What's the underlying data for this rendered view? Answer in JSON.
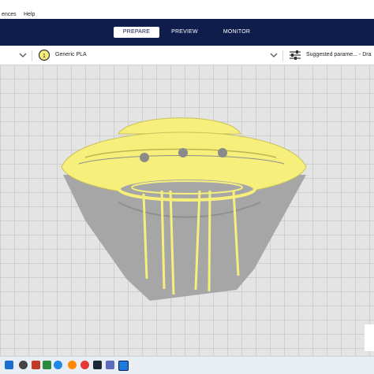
{
  "menu": {
    "preferences": "ences",
    "help": "Help"
  },
  "stages": {
    "prepare": "PREPARE",
    "preview": "PREVIEW",
    "monitor": "MONITOR"
  },
  "toolbar": {
    "material_index": "1",
    "material": "Generic PLA",
    "print_settings": "Suggested parame... - Dra"
  },
  "colors": {
    "header": "#0f1d4d",
    "filament": "#f6ef7c",
    "model_shadow": "#a6a6a6",
    "build_plate": "#e4e4e4"
  },
  "taskbar": {
    "icons": [
      "windows-icon",
      "search-icon",
      "task-view-icon",
      "store-icon",
      "edge-icon",
      "firefox-icon",
      "chrome-icon",
      "steam-icon",
      "app-icon",
      "cura-icon"
    ]
  }
}
